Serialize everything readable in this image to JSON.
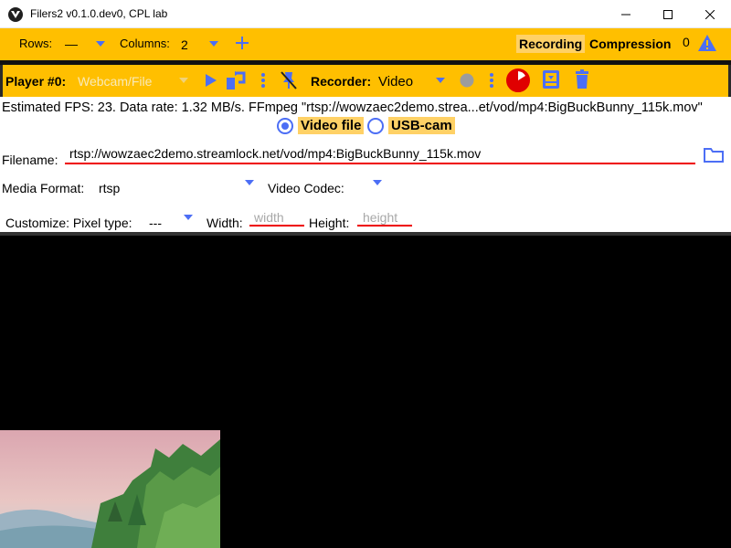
{
  "window": {
    "title": "Filers2 v0.1.0.dev0, CPL lab"
  },
  "top_bar": {
    "rows_label": "Rows:",
    "rows_value": "—",
    "columns_label": "Columns:",
    "columns_value": "2",
    "recording_label": "Recording",
    "compression_label": "Compression",
    "error_count": "0"
  },
  "player_bar": {
    "player_label": "Player #0:",
    "source_placeholder": "Webcam/File",
    "recorder_label": "Recorder:",
    "recorder_value": "Video"
  },
  "status": {
    "fps_text": "Estimated FPS: 23. Data rate: 1.32 MB/s. FFmpeg \"rtsp://wowzaec2demo.strea...et/vod/mp4:BigBuckBunny_115k.mov\""
  },
  "source_choice": {
    "video_file_label": "Video file",
    "usb_cam_label": "USB-cam",
    "selected": "Video file"
  },
  "filename": {
    "label": "Filename:",
    "value": "rtsp://wowzaec2demo.streamlock.net/vod/mp4:BigBuckBunny_115k.mov"
  },
  "media": {
    "format_label": "Media Format:",
    "format_value": "rtsp",
    "codec_label": "Video Codec:",
    "codec_value": ""
  },
  "customize": {
    "pixel_type_label": "Customize: Pixel type:",
    "pixel_type_value": "---",
    "width_label": "Width:",
    "width_placeholder": "width",
    "height_label": "Height:",
    "height_placeholder": "height"
  },
  "colors": {
    "toolbar": "#ffbf00",
    "accent": "#4c6ef5",
    "record_red": "#e00000",
    "underline": "#e00000"
  }
}
